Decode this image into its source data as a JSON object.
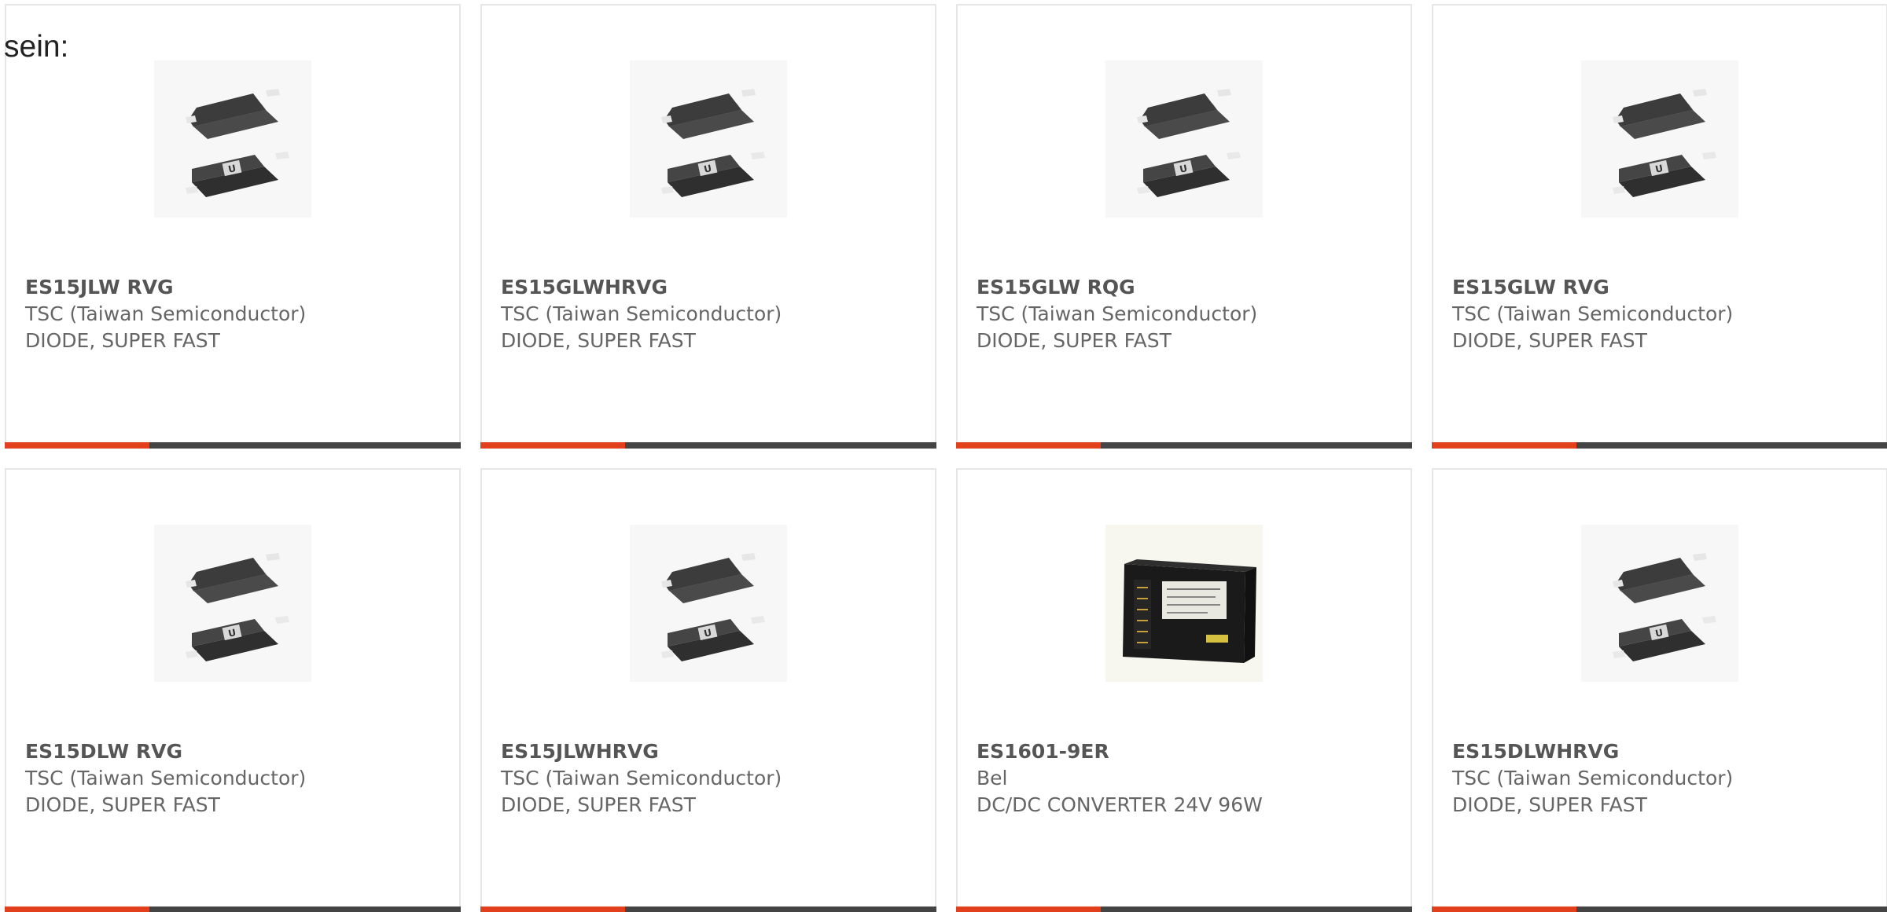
{
  "lead_text": "sein:",
  "accent_color": "#e2401c",
  "bar_color": "#444444",
  "products": [
    {
      "part_number": "ES15JLW RVG",
      "manufacturer": "TSC (Taiwan Semiconductor)",
      "description": "DIODE, SUPER FAST",
      "image": "smd-diode"
    },
    {
      "part_number": "ES15GLWHRVG",
      "manufacturer": "TSC (Taiwan Semiconductor)",
      "description": "DIODE, SUPER FAST",
      "image": "smd-diode"
    },
    {
      "part_number": "ES15GLW RQG",
      "manufacturer": "TSC (Taiwan Semiconductor)",
      "description": "DIODE, SUPER FAST",
      "image": "smd-diode"
    },
    {
      "part_number": "ES15GLW RVG",
      "manufacturer": "TSC (Taiwan Semiconductor)",
      "description": "DIODE, SUPER FAST",
      "image": "smd-diode"
    },
    {
      "part_number": "ES15DLW RVG",
      "manufacturer": "TSC (Taiwan Semiconductor)",
      "description": "DIODE, SUPER FAST",
      "image": "smd-diode"
    },
    {
      "part_number": "ES15JLWHRVG",
      "manufacturer": "TSC (Taiwan Semiconductor)",
      "description": "DIODE, SUPER FAST",
      "image": "smd-diode"
    },
    {
      "part_number": "ES1601-9ER",
      "manufacturer": "Bel",
      "description": "DC/DC CONVERTER 24V 96W",
      "image": "dc-dc-converter"
    },
    {
      "part_number": "ES15DLWHRVG",
      "manufacturer": "TSC (Taiwan Semiconductor)",
      "description": "DIODE, SUPER FAST",
      "image": "smd-diode"
    }
  ]
}
